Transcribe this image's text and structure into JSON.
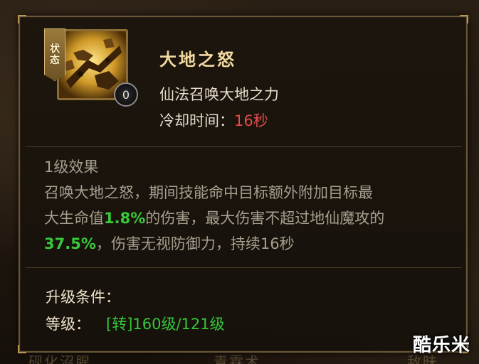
{
  "background": {
    "left_stub": "砚化沼腥",
    "mid_stub": "青霖术",
    "right_stub": "敌昧"
  },
  "skill": {
    "status_badge": [
      "状",
      "态"
    ],
    "icon": "earth-fury-icon",
    "level": "0",
    "name": "大地之怒",
    "description": "仙法召唤大地之力",
    "cooldown_label": "冷却时间：",
    "cooldown_value": "16秒"
  },
  "effect": {
    "title": "1级效果",
    "line1": "召唤大地之怒，期间技能命中目标额外附加目标最",
    "line2_prefix": "大生命值",
    "line2_highlight": "1.8%",
    "line2_suffix": "的伤害，最大伤害不超过地仙魔攻的",
    "line3_highlight": "37.5%",
    "line3_suffix": "，伤害无视防御力，持续16秒"
  },
  "upgrade": {
    "title": "升级条件：",
    "level_label": "等级：",
    "level_value": "[转]160级/121级"
  },
  "watermark": "酷乐米",
  "colors": {
    "highlight_green": "#38c83a",
    "cooldown_red": "#e04b4b",
    "title_gold": "#f1d9a0",
    "border_gold": "#6b5738"
  }
}
